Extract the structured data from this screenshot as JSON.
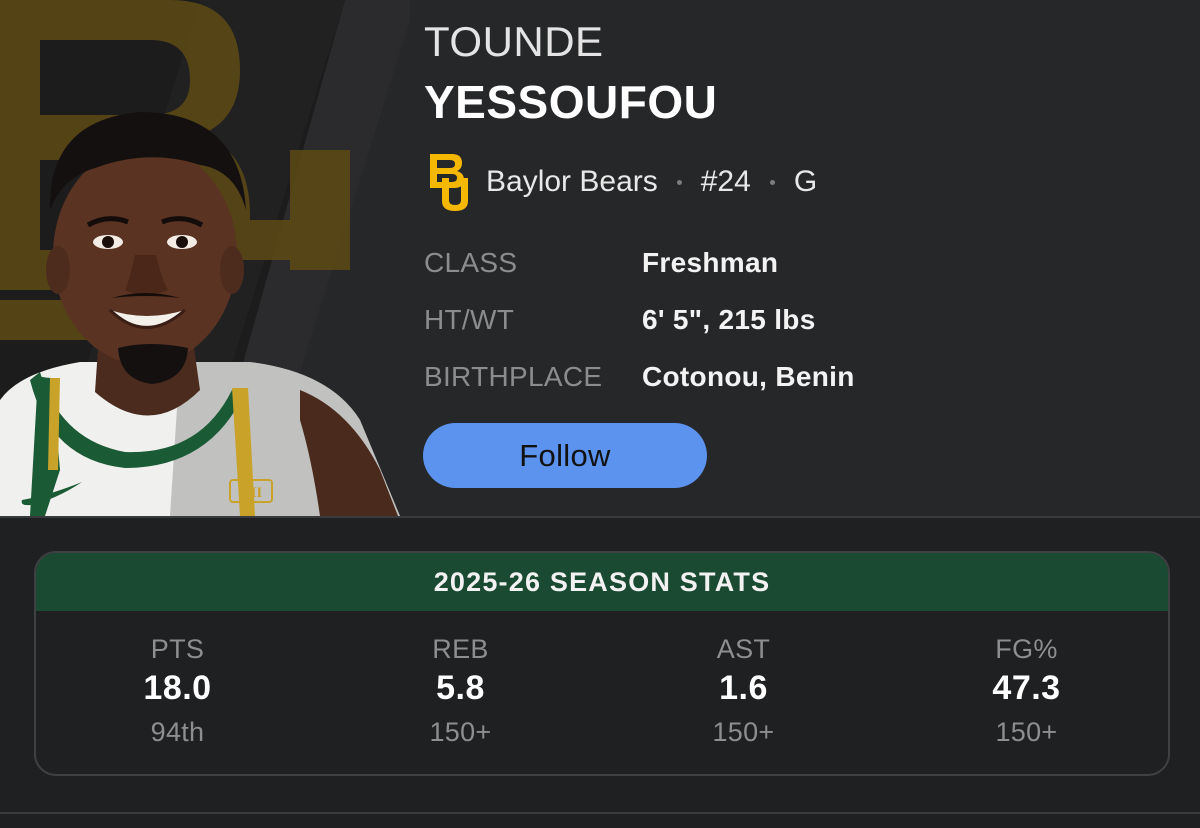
{
  "player": {
    "first_name": "TOUNDE",
    "last_name": "YESSOUFOU",
    "team": "Baylor Bears",
    "number": "#24",
    "position": "G",
    "team_logo": "baylor-bu-logo",
    "photo": "player-headshot"
  },
  "bio": [
    {
      "label": "CLASS",
      "value": "Freshman"
    },
    {
      "label": "HT/WT",
      "value": "6' 5\", 215 lbs"
    },
    {
      "label": "BIRTHPLACE",
      "value": "Cotonou, Benin"
    }
  ],
  "follow_button": {
    "label": "Follow"
  },
  "season_stats": {
    "title": "2025-26 SEASON STATS",
    "stats": [
      {
        "label": "PTS",
        "value": "18.0",
        "rank": "94th"
      },
      {
        "label": "REB",
        "value": "5.8",
        "rank": "150+"
      },
      {
        "label": "AST",
        "value": "1.6",
        "rank": "150+"
      },
      {
        "label": "FG%",
        "value": "47.3",
        "rank": "150+"
      }
    ]
  },
  "colors": {
    "background": "#1f2022",
    "header_background": "#262729",
    "accent_blue": "#5b93ee",
    "stats_header_green": "#1b4a32",
    "baylor_gold": "#f5b800"
  }
}
